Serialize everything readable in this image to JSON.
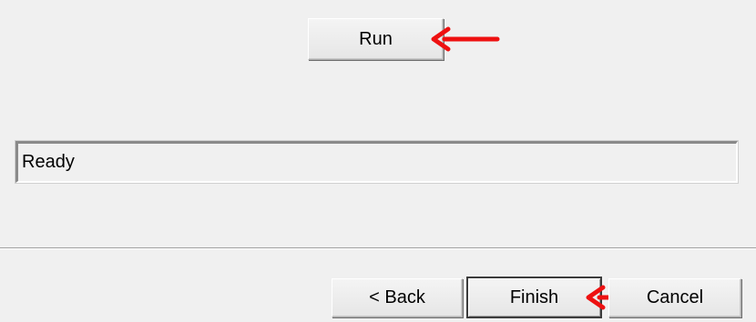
{
  "wizard": {
    "run_label": "Run",
    "status_value": "Ready",
    "back_label": "< Back",
    "finish_label": "Finish",
    "cancel_label": "Cancel"
  },
  "annotations": {
    "arrow_color": "#ee1111",
    "arrow_icon": "left-arrow-icon"
  },
  "colors": {
    "background": "#f0f0f0",
    "button_face": "#e9e9e9",
    "annotation_arrow": "#ee1111"
  }
}
